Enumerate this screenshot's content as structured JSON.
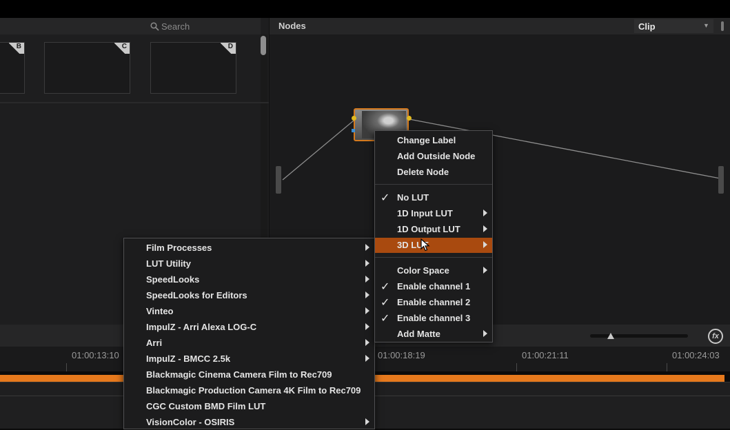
{
  "gallery": {
    "search_placeholder": "Search",
    "stills": [
      "B",
      "C",
      "D"
    ]
  },
  "nodes_panel": {
    "title": "Nodes",
    "mode_select": "Clip"
  },
  "context_menu": {
    "items": [
      {
        "label": "Change Label",
        "checked": false,
        "submenu": false
      },
      {
        "label": "Add Outside Node",
        "checked": false,
        "submenu": false
      },
      {
        "label": "Delete Node",
        "checked": false,
        "submenu": false
      },
      {
        "label": "No LUT",
        "checked": true,
        "submenu": false
      },
      {
        "label": "1D Input LUT",
        "checked": false,
        "submenu": true
      },
      {
        "label": "1D Output LUT",
        "checked": false,
        "submenu": true
      },
      {
        "label": "3D LUT",
        "checked": false,
        "submenu": true,
        "highlighted": true
      },
      {
        "label": "Color Space",
        "checked": false,
        "submenu": true
      },
      {
        "label": "Enable channel 1",
        "checked": true,
        "submenu": false
      },
      {
        "label": "Enable channel 2",
        "checked": true,
        "submenu": false
      },
      {
        "label": "Enable channel 3",
        "checked": true,
        "submenu": false
      },
      {
        "label": "Add Matte",
        "checked": false,
        "submenu": true
      }
    ]
  },
  "lut_submenu": {
    "items": [
      {
        "label": "Film Processes",
        "submenu": true
      },
      {
        "label": "LUT Utility",
        "submenu": true
      },
      {
        "label": "SpeedLooks",
        "submenu": true
      },
      {
        "label": "SpeedLooks for Editors",
        "submenu": true
      },
      {
        "label": "Vinteo",
        "submenu": true
      },
      {
        "label": "ImpulZ - Arri Alexa LOG-C",
        "submenu": true
      },
      {
        "label": "Arri",
        "submenu": true
      },
      {
        "label": "ImpulZ - BMCC 2.5k",
        "submenu": true
      },
      {
        "label": "Blackmagic Cinema Camera Film to Rec709",
        "submenu": false
      },
      {
        "label": "Blackmagic Production Camera 4K Film to Rec709",
        "submenu": false
      },
      {
        "label": "CGC Custom BMD Film LUT",
        "submenu": false
      },
      {
        "label": "VisionColor - OSIRIS",
        "submenu": true
      }
    ]
  },
  "timeline": {
    "timecodes": [
      "01:00:13:10",
      "01:00:18:19",
      "01:00:21:11",
      "01:00:24:03"
    ],
    "accent_color": "#e6791d",
    "icons": [
      "fx-icon",
      "zoom-slider"
    ]
  }
}
